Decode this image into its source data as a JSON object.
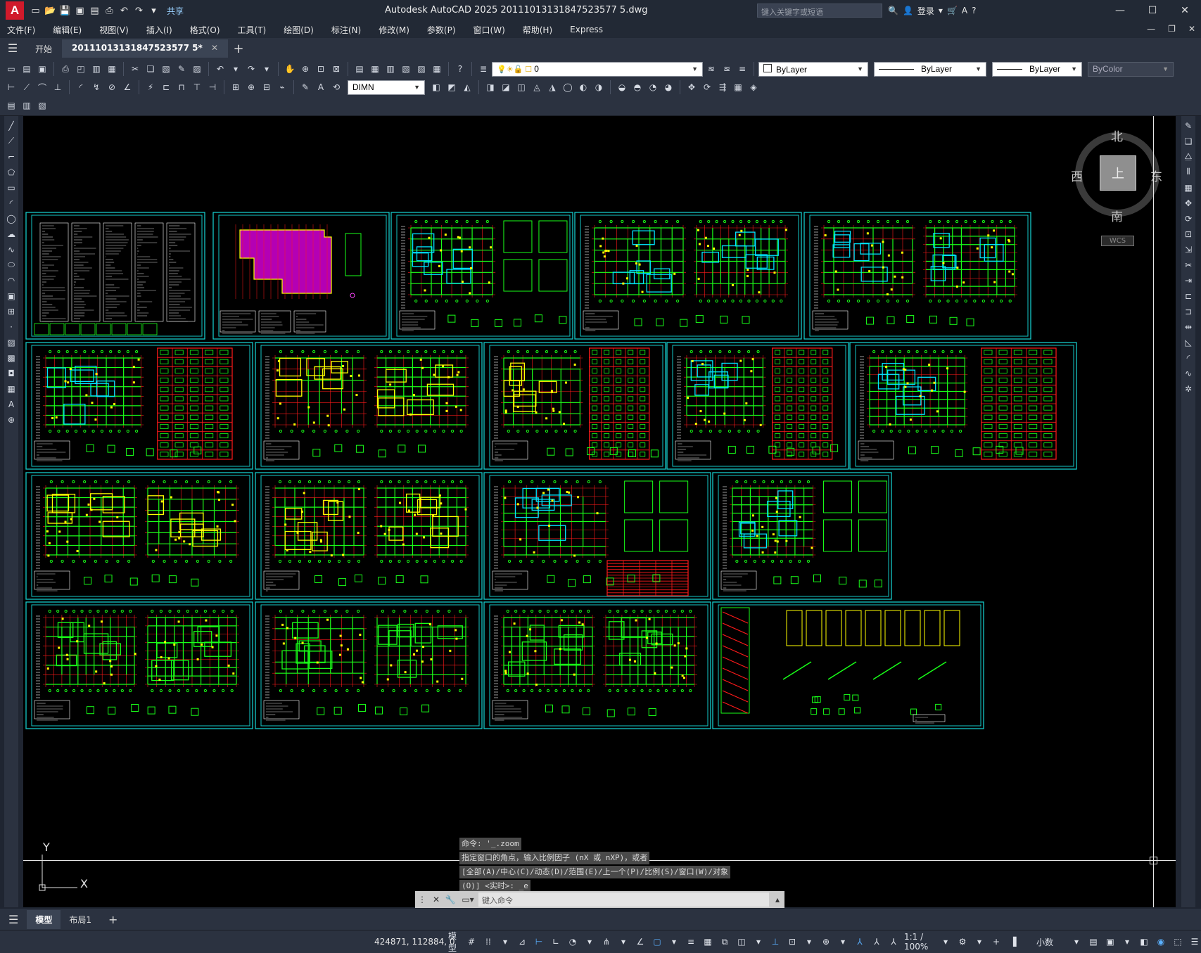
{
  "titlebar": {
    "app_logo": "A",
    "title": "Autodesk AutoCAD 2025    20111013131847523577 5.dwg",
    "share": "共享",
    "search_placeholder": "键入关键字或短语",
    "login": "登录",
    "window_buttons": [
      "—",
      "☐",
      "✕"
    ]
  },
  "menu": {
    "items": [
      "文件(F)",
      "编辑(E)",
      "视图(V)",
      "插入(I)",
      "格式(O)",
      "工具(T)",
      "绘图(D)",
      "标注(N)",
      "修改(M)",
      "参数(P)",
      "窗口(W)",
      "帮助(H)",
      "Express"
    ]
  },
  "tabs": {
    "start": "开始",
    "drawing": "20111013131847523577 5*"
  },
  "properties": {
    "layer_value": "0",
    "color": "ByLayer",
    "linetype": "ByLayer",
    "lineweight": "ByLayer",
    "plotstyle": "ByColor",
    "dimstyle": "DIMN"
  },
  "viewcube": {
    "north": "北",
    "south": "南",
    "east": "东",
    "west": "西",
    "top": "上",
    "wcs": "WCS"
  },
  "ucs": {
    "x": "X",
    "y": "Y"
  },
  "command": {
    "history": [
      "命令: '_.zoom",
      "指定窗口的角点，输入比例因子 (nX 或 nXP)，或者",
      "[全部(A)/中心(C)/动态(D)/范围(E)/上一个(P)/比例(S)/窗口(W)/对象",
      "(O)] <实时>: _e"
    ],
    "placeholder": "键入命令"
  },
  "layout_tabs": [
    "模型",
    "布局1"
  ],
  "status": {
    "coords": "424871, 112884, 0",
    "model": "模型",
    "scale": "1:1 / 100%",
    "units": "小数"
  },
  "colors": {
    "frame": "#14c8c8",
    "line_green": "#18ff18",
    "line_red": "#ff1a1a",
    "line_yellow": "#ffff00",
    "line_cyan": "#00e5ff",
    "hatch_magenta": "#b400b4"
  }
}
